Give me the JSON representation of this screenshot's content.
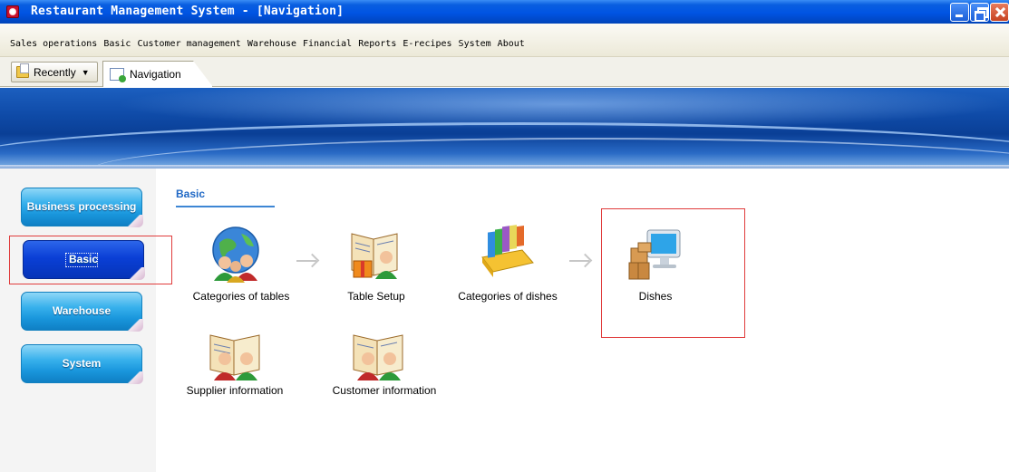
{
  "window": {
    "title": "Restaurant Management System - [Navigation]"
  },
  "menubar": {
    "items": [
      "Sales operations",
      "Basic",
      "Customer management",
      "Warehouse",
      "Financial",
      "Reports",
      "E-recipes",
      "System",
      "About"
    ]
  },
  "tabs": {
    "recently_label": "Recently",
    "navigation_tab": "Navigation"
  },
  "sidebar": {
    "items": [
      {
        "label": "Business processing",
        "active": false
      },
      {
        "label": "Basic",
        "active": true
      },
      {
        "label": "Warehouse",
        "active": false
      },
      {
        "label": "System",
        "active": false
      }
    ]
  },
  "main": {
    "section_title": "Basic",
    "items": [
      {
        "label": "Categories of tables",
        "icon": "globe-people-icon"
      },
      {
        "label": "Table Setup",
        "icon": "book-gift-icon"
      },
      {
        "label": "Categories of dishes",
        "icon": "bookshelf-icon"
      },
      {
        "label": "Dishes",
        "icon": "computer-boxes-icon"
      },
      {
        "label": "Supplier information",
        "icon": "book-people-icon"
      },
      {
        "label": "Customer information",
        "icon": "book-people-icon"
      }
    ]
  },
  "colors": {
    "title_bar": "#0054e3",
    "sidebar_button": "#1996dc",
    "sidebar_button_active": "#0a3fd6",
    "section_title": "#1f68c5",
    "highlight_box": "#e03c3c"
  }
}
